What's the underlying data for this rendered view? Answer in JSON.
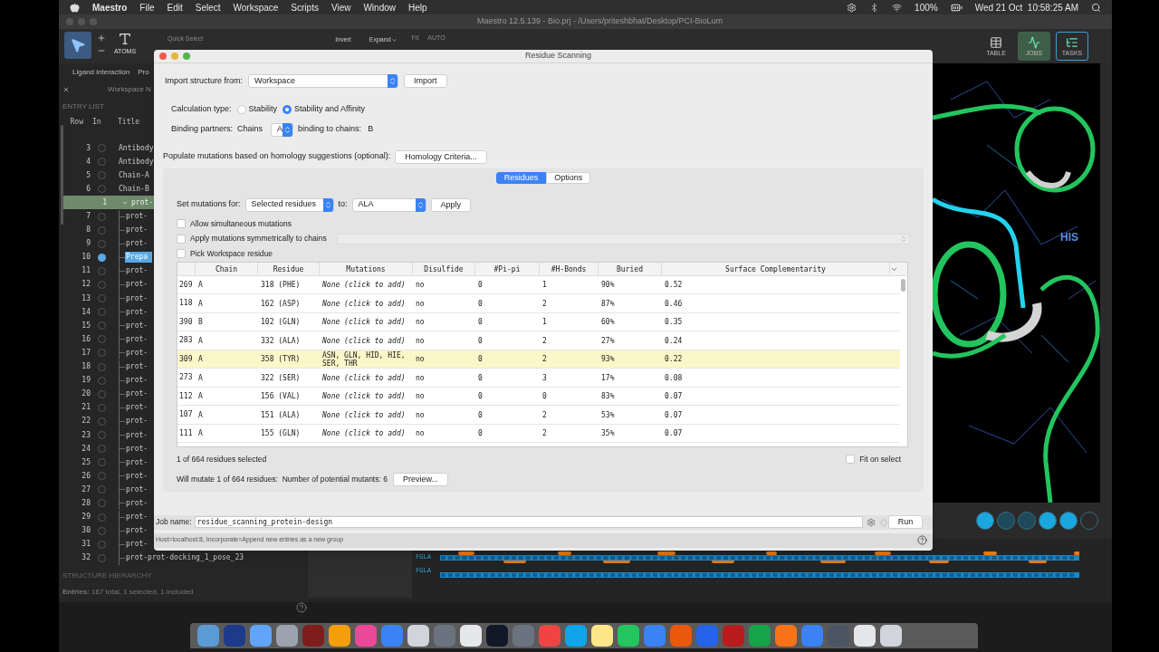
{
  "menubar": {
    "app": "Maestro",
    "menus": [
      "File",
      "Edit",
      "Select",
      "Workspace",
      "Scripts",
      "View",
      "Window",
      "Help"
    ],
    "battery": "100%",
    "clock": "Wed 21 Oct  10:58:25 AM"
  },
  "window": {
    "title": "Maestro 12.5.139 - Bio.prj - /Users/priteshbhat/Desktop/PCI-BioLum"
  },
  "toolbar": {
    "atoms_label": "ATOMS",
    "quick_select": "Quick Select",
    "invert": "Invert",
    "expand": "Expand",
    "fit": "Fit",
    "auto": "AUTO",
    "right_buttons": [
      {
        "label": "TABLE",
        "selected": false
      },
      {
        "label": "JOBS",
        "selected": true
      },
      {
        "label": "TASKS",
        "selected": false
      }
    ]
  },
  "left_panel": {
    "tabs": [
      "Ligand interaction",
      "Pro"
    ],
    "workspace_tab": "Workspace N",
    "entry_list": {
      "title": "ENTRY LIST",
      "columns": [
        "Row",
        "In",
        "Title"
      ],
      "rows": [
        {
          "kind": "entry",
          "row": "3",
          "title": "Antibody",
          "included": false,
          "selected": false
        },
        {
          "kind": "entry",
          "row": "4",
          "title": "Antibody",
          "included": false,
          "selected": false
        },
        {
          "kind": "entry",
          "row": "5",
          "title": "Chain-A",
          "included": false,
          "selected": false
        },
        {
          "kind": "entry",
          "row": "6",
          "title": "Chain-B",
          "included": false,
          "selected": false
        },
        {
          "kind": "group",
          "row": "1",
          "title": "prot-",
          "expanded": true,
          "children": [
            {
              "kind": "entry",
              "row": "7",
              "title": "prot-",
              "included": false,
              "selected": false
            },
            {
              "kind": "entry",
              "row": "8",
              "title": "prot-",
              "included": false,
              "selected": false
            },
            {
              "kind": "entry",
              "row": "9",
              "title": "prot-",
              "included": false,
              "selected": false
            },
            {
              "kind": "entry",
              "row": "10",
              "title": "Prepa",
              "included": true,
              "selected": true
            },
            {
              "kind": "entry",
              "row": "11",
              "title": "prot-",
              "included": false,
              "selected": false
            },
            {
              "kind": "entry",
              "row": "12",
              "title": "prot-",
              "included": false,
              "selected": false
            },
            {
              "kind": "entry",
              "row": "13",
              "title": "prot-",
              "included": false,
              "selected": false
            },
            {
              "kind": "entry",
              "row": "14",
              "title": "prot-",
              "included": false,
              "selected": false
            },
            {
              "kind": "entry",
              "row": "15",
              "title": "prot-",
              "included": false,
              "selected": false
            },
            {
              "kind": "entry",
              "row": "16",
              "title": "prot-",
              "included": false,
              "selected": false
            },
            {
              "kind": "entry",
              "row": "17",
              "title": "prot-",
              "included": false,
              "selected": false
            },
            {
              "kind": "entry",
              "row": "18",
              "title": "prot-",
              "included": false,
              "selected": false
            },
            {
              "kind": "entry",
              "row": "19",
              "title": "prot-",
              "included": false,
              "selected": false
            },
            {
              "kind": "entry",
              "row": "20",
              "title": "prot-",
              "included": false,
              "selected": false
            },
            {
              "kind": "entry",
              "row": "21",
              "title": "prot-",
              "included": false,
              "selected": false
            },
            {
              "kind": "entry",
              "row": "22",
              "title": "prot-",
              "included": false,
              "selected": false
            },
            {
              "kind": "entry",
              "row": "23",
              "title": "prot-",
              "included": false,
              "selected": false
            },
            {
              "kind": "entry",
              "row": "24",
              "title": "prot-",
              "included": false,
              "selected": false
            },
            {
              "kind": "entry",
              "row": "25",
              "title": "prot-",
              "included": false,
              "selected": false
            },
            {
              "kind": "entry",
              "row": "26",
              "title": "prot-",
              "included": false,
              "selected": false
            },
            {
              "kind": "entry",
              "row": "27",
              "title": "prot-",
              "included": false,
              "selected": false
            },
            {
              "kind": "entry",
              "row": "28",
              "title": "prot-",
              "included": false,
              "selected": false
            },
            {
              "kind": "entry",
              "row": "29",
              "title": "prot-",
              "included": false,
              "selected": false
            },
            {
              "kind": "entry",
              "row": "30",
              "title": "prot-",
              "included": false,
              "selected": false
            },
            {
              "kind": "entry",
              "row": "31",
              "title": "prot-",
              "included": false,
              "selected": false
            },
            {
              "kind": "entry",
              "row": "32",
              "title": "prot-prot-docking_1_pose_23",
              "included": false,
              "selected": false
            }
          ]
        }
      ]
    },
    "structure_hierarchy": "STRUCTURE HIERARCHY",
    "entries_summary": "**Entries:** 167 total, 1 selected, 1 included"
  },
  "dialog": {
    "title": "Residue Scanning",
    "import_label": "Import structure from:",
    "import_source": "Workspace",
    "import_button": "Import",
    "calculation_label": "Calculation type:",
    "calculation_options": [
      {
        "label": "Stability",
        "selected": false
      },
      {
        "label": "Stability and Affinity",
        "selected": true
      }
    ],
    "binding_label": "Binding partners:",
    "chains_label": "Chains",
    "chain_value": "A",
    "binding_to_label": "binding to chains:",
    "binding_to_value": "B",
    "homology_label": "Populate mutations based on homology suggestions (optional):",
    "homology_button": "Homology Criteria...",
    "tabs": [
      {
        "label": "Residues",
        "selected": true
      },
      {
        "label": "Options",
        "selected": false
      }
    ],
    "set_label": "Set mutations for:",
    "set_value": "Selected residues",
    "to_label": "to:",
    "to_value": "ALA",
    "apply_button": "Apply",
    "checkboxes": [
      {
        "label": "Allow simultaneous mutations",
        "checked": false
      },
      {
        "label": "Apply mutations symmetrically to chains",
        "checked": false
      },
      {
        "label": "Pick Workspace residue",
        "checked": false
      }
    ],
    "table": {
      "columns": [
        "Chain",
        "Residue",
        "Mutations",
        "Disulfide",
        "#Pi-pi",
        "#H-Bonds",
        "Buried",
        "Surface Complementarity"
      ],
      "rows": [
        {
          "index": "269",
          "chain": "A",
          "residue": "318 (PHE)",
          "mutations": "None (click to add)",
          "mutations_assigned": false,
          "disulfide": "no",
          "pi_pi": "0",
          "h_bonds": "1",
          "buried": "90%",
          "surface_complementarity": "0.52",
          "selected": false
        },
        {
          "index": "118",
          "chain": "A",
          "residue": "162 (ASP)",
          "mutations": "None (click to add)",
          "mutations_assigned": false,
          "disulfide": "no",
          "pi_pi": "0",
          "h_bonds": "2",
          "buried": "87%",
          "surface_complementarity": "0.46",
          "selected": false
        },
        {
          "index": "390",
          "chain": "B",
          "residue": "102 (GLN)",
          "mutations": "None (click to add)",
          "mutations_assigned": false,
          "disulfide": "no",
          "pi_pi": "0",
          "h_bonds": "1",
          "buried": "60%",
          "surface_complementarity": "0.35",
          "selected": false
        },
        {
          "index": "283",
          "chain": "A",
          "residue": "332 (ALA)",
          "mutations": "None (click to add)",
          "mutations_assigned": false,
          "disulfide": "no",
          "pi_pi": "0",
          "h_bonds": "2",
          "buried": "27%",
          "surface_complementarity": "0.24",
          "selected": false
        },
        {
          "index": "309",
          "chain": "A",
          "residue": "358 (TYR)",
          "mutations": "ASN, GLN, HID, HIE, SER, THR",
          "mutations_assigned": true,
          "disulfide": "no",
          "pi_pi": "0",
          "h_bonds": "2",
          "buried": "93%",
          "surface_complementarity": "0.22",
          "selected": true
        },
        {
          "index": "273",
          "chain": "A",
          "residue": "322 (SER)",
          "mutations": "None (click to add)",
          "mutations_assigned": false,
          "disulfide": "no",
          "pi_pi": "0",
          "h_bonds": "3",
          "buried": "17%",
          "surface_complementarity": "0.08",
          "selected": false
        },
        {
          "index": "112",
          "chain": "A",
          "residue": "156 (VAL)",
          "mutations": "None (click to add)",
          "mutations_assigned": false,
          "disulfide": "no",
          "pi_pi": "0",
          "h_bonds": "0",
          "buried": "83%",
          "surface_complementarity": "0.07",
          "selected": false
        },
        {
          "index": "107",
          "chain": "A",
          "residue": "151 (ALA)",
          "mutations": "None (click to add)",
          "mutations_assigned": false,
          "disulfide": "no",
          "pi_pi": "0",
          "h_bonds": "2",
          "buried": "53%",
          "surface_complementarity": "0.07",
          "selected": false
        },
        {
          "index": "111",
          "chain": "A",
          "residue": "155 (GLN)",
          "mutations": "None (click to add)",
          "mutations_assigned": false,
          "disulfide": "no",
          "pi_pi": "0",
          "h_bonds": "2",
          "buried": "35%",
          "surface_complementarity": "0.07",
          "selected": false
        }
      ]
    },
    "selection_summary": "1 of 664 residues selected",
    "fit_on_select": {
      "label": "Fit on select",
      "checked": false
    },
    "mutate_summary": "Will mutate 1 of 664 residues:  Number of potential mutants: 6",
    "preview_button": "Preview...",
    "job_label": "Job name:",
    "job_name": "residue_scanning_protein-design",
    "run_button": "Run",
    "status": "Host=localhost:8, Incorporate=Append new entries as a new group"
  },
  "viewer": {
    "label": "HIS"
  },
  "sequence": {
    "rows": [
      "FGLA",
      "FGLA"
    ]
  }
}
